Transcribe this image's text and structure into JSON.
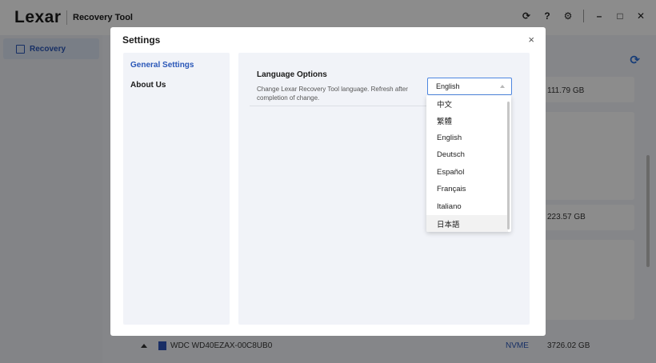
{
  "app": {
    "logo": "Lexar",
    "title": "Recovery Tool"
  },
  "sidebar": {
    "items": [
      {
        "label": "Recovery"
      }
    ]
  },
  "main": {
    "capacities": [
      "111.79 GB",
      "223.57 GB"
    ],
    "bottom_drive": {
      "name": "WDC WD40EZAX-00C8UB0",
      "interface": "NVME",
      "capacity": "3726.02 GB"
    }
  },
  "dialog": {
    "title": "Settings",
    "close_label": "×",
    "nav": [
      {
        "label": "General Settings",
        "active": true
      },
      {
        "label": "About Us",
        "active": false
      }
    ],
    "language": {
      "title": "Language Options",
      "description": "Change Lexar Recovery Tool language. Refresh after completion of change.",
      "selected": "English",
      "options": [
        "中文",
        "繁體",
        "English",
        "Deutsch",
        "Español",
        "Français",
        "Italiano",
        "日本語"
      ]
    }
  },
  "colors": {
    "accent": "#2a57b8",
    "focus_border": "#4d86e0"
  }
}
